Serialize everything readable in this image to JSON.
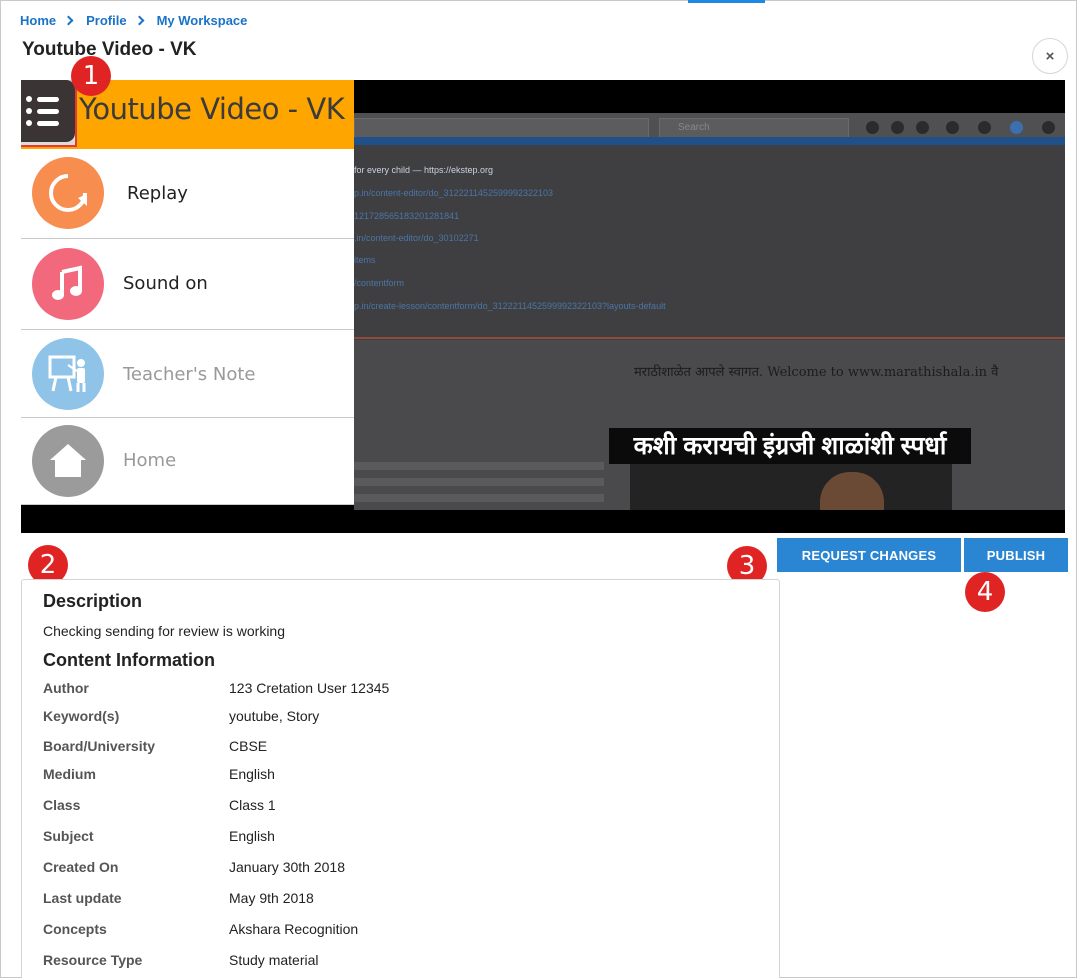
{
  "breadcrumb": {
    "home": "Home",
    "profile": "Profile",
    "workspace": "My Workspace"
  },
  "page": {
    "title": "Youtube Video - VK",
    "close_symbol": "×"
  },
  "player": {
    "title": "Youtube Video - VK",
    "menu_icon": "list-menu-icon",
    "menu": [
      {
        "label": "Replay",
        "icon": "replay-icon",
        "color": "#f78d4f",
        "label_color": "#222222"
      },
      {
        "label": "Sound on",
        "icon": "music-note-icon",
        "color": "#f2687d",
        "label_color": "#222222"
      },
      {
        "label": "Teacher's Note",
        "icon": "teacher-board-icon",
        "color": "#8fc4e8",
        "label_color": "#999999"
      },
      {
        "label": "Home",
        "icon": "home-icon",
        "color": "#9b9b9b",
        "label_color": "#999999"
      }
    ],
    "video": {
      "search_placeholder": "Search",
      "link_lines": [
        "for every child  —  https://ekstep.org",
        "p.in/content-editor/do_3122211452599992322103",
        "121728565183201281841",
        ".in/content-editor/do_30102271",
        "items",
        "/contentform",
        "p.in/create-lesson/contentform/do_3122211452599992322103?layouts-default"
      ],
      "welcome_text": "मराठीशाळेत आपले स्वागत. Welcome to www.marathishala.in वै",
      "banner_text": "कशी करायची इंग्रजी शाळांशी स्पर्धा"
    }
  },
  "annotations": {
    "one": "1",
    "two": "2",
    "three": "3",
    "four": "4"
  },
  "actions": {
    "request_changes": "REQUEST CHANGES",
    "publish": "PUBLISH"
  },
  "description": {
    "heading": "Description",
    "text": "Checking sending for review is working"
  },
  "content_info": {
    "heading": "Content Information",
    "rows": [
      {
        "label": "Author",
        "value": "123 Cretation User 12345"
      },
      {
        "label": "Keyword(s)",
        "value": "youtube, Story"
      },
      {
        "label": "Board/University",
        "value": "CBSE"
      },
      {
        "label": "Medium",
        "value": "English"
      },
      {
        "label": "Class",
        "value": "Class 1"
      },
      {
        "label": "Subject",
        "value": "English"
      },
      {
        "label": "Created On",
        "value": "January 30th 2018"
      },
      {
        "label": "Last update",
        "value": "May 9th 2018"
      },
      {
        "label": "Concepts",
        "value": "Akshara Recognition"
      },
      {
        "label": "Resource Type",
        "value": "Study material"
      }
    ]
  },
  "colors": {
    "accent": "#2a86d2",
    "title_bar": "#ffa500",
    "badge": "#e02424",
    "link": "#1a73c8"
  }
}
